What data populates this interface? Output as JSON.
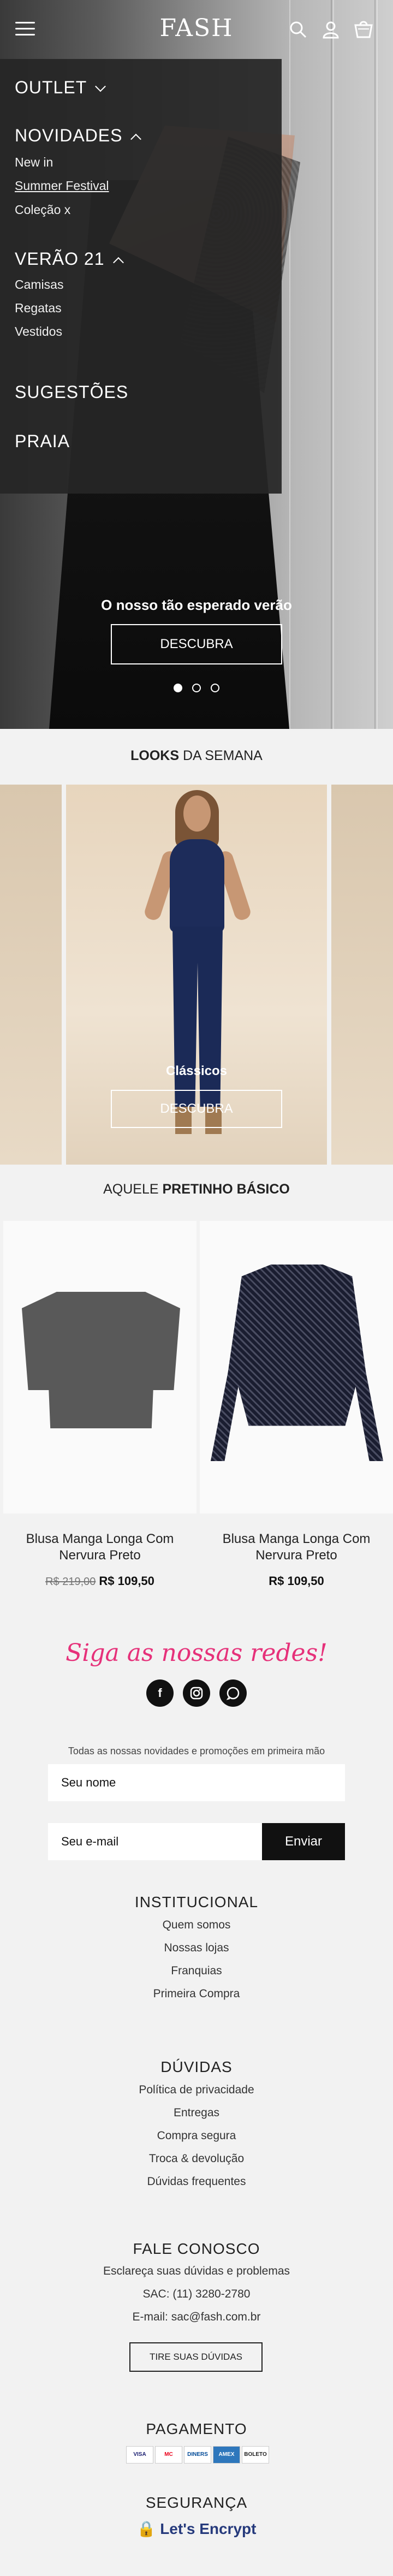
{
  "header": {
    "logo": "FASH"
  },
  "nav": {
    "outlet": "OUTLET",
    "novidades": "NOVIDADES",
    "novidades_items": [
      "New in",
      "Summer Festival",
      "Coleção x"
    ],
    "verao": "VERÃO 21",
    "verao_items": [
      "Camisas",
      "Regatas",
      "Vestidos"
    ],
    "sugestoes": "SUGESTÕES",
    "praia": "PRAIA"
  },
  "hero": {
    "caption": "O nosso tão esperado verão",
    "button": "DESCUBRA",
    "slides": 3,
    "active_slide": 1
  },
  "looks": {
    "title_bold": "LOOKS",
    "title_rest": " DA SEMANA",
    "label": "Clássicos",
    "button": "DESCUBRA"
  },
  "pretinho": {
    "title_rest": "AQUELE ",
    "title_bold": "PRETINHO BÁSICO",
    "products": [
      {
        "name": "Blusa Manga Longa Com Nervura Preto",
        "old_price": "R$ 219,00",
        "price": "R$ 109,50"
      },
      {
        "name": "Blusa Manga Longa Com Nervura Preto",
        "old_price": "",
        "price": "R$ 109,50"
      }
    ]
  },
  "social": {
    "title": "Siga as nossas redes!",
    "icons": [
      "facebook-icon",
      "instagram-icon",
      "whatsapp-icon"
    ]
  },
  "newsletter": {
    "text": "Todas as nossas novidades e promoções em primeira mão",
    "name_placeholder": "Seu nome",
    "email_placeholder": "Seu e-mail",
    "send": "Enviar"
  },
  "footer": {
    "institucional": {
      "title": "INSTITUCIONAL",
      "links": [
        "Quem somos",
        "Nossas lojas",
        "Franquias",
        "Primeira Compra"
      ]
    },
    "duvidas": {
      "title": "DÚVIDAS",
      "links": [
        "Política de privacidade",
        "Entregas",
        "Compra segura",
        "Troca & devolução",
        "Dúvidas frequentes"
      ]
    },
    "contato": {
      "title": "FALE CONOSCO",
      "text": "Esclareça suas dúvidas e problemas",
      "sac": "SAC: (11) 3280-2780",
      "email": "E-mail: sac@fash.com.br",
      "button": "TIRE SUAS DÚVIDAS"
    },
    "pagamento": {
      "title": "PAGAMENTO",
      "cards": [
        "VISA",
        "MC",
        "DINERS",
        "AMEX",
        "BOLETO"
      ]
    },
    "seguranca": {
      "title": "SEGURANÇA",
      "badge": "Let's Encrypt"
    }
  }
}
